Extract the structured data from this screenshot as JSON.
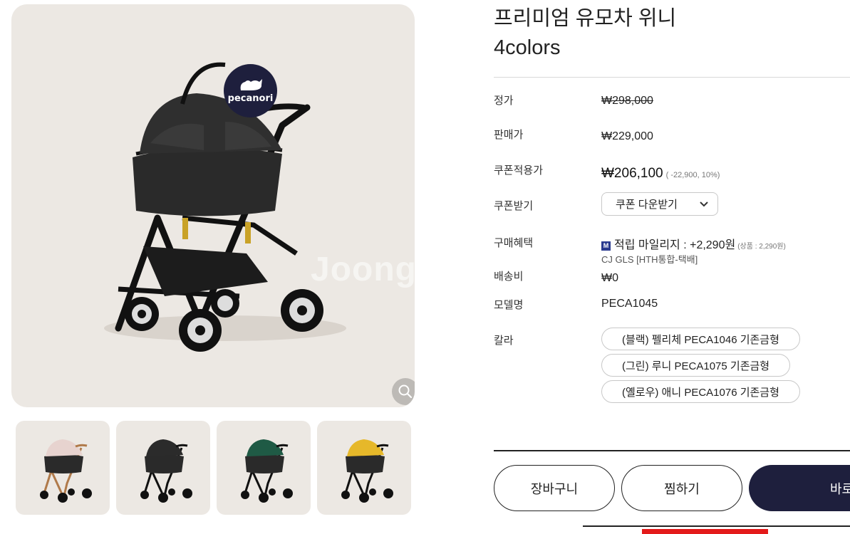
{
  "product": {
    "title_line1": "프리미엄 유모차 위니",
    "title_line2": "4colors"
  },
  "gallery": {
    "brand_badge": "pecanori",
    "watermark": "Joong",
    "thumbnails": [
      {
        "name": "rose-gold-pink",
        "canopy_color": "#e7d3cf",
        "frame_color": "#b07a4a"
      },
      {
        "name": "black",
        "canopy_color": "#2b2b2b",
        "frame_color": "#111111"
      },
      {
        "name": "green",
        "canopy_color": "#1f5a45",
        "frame_color": "#111111"
      },
      {
        "name": "yellow",
        "canopy_color": "#e6b82a",
        "frame_color": "#111111"
      }
    ]
  },
  "info": {
    "list_price_label": "정가",
    "list_price": "₩298,000",
    "sale_price_label": "판매가",
    "sale_price": "₩229,000",
    "coupon_price_label": "쿠폰적용가",
    "coupon_price": "₩206,100",
    "coupon_discount_note": "( -22,900, 10%)",
    "coupon_label": "쿠폰받기",
    "coupon_button": "쿠폰 다운받기",
    "benefit_label": "구매혜택",
    "mileage_icon": "M",
    "mileage_text": "적립 마일리지 : +2,290원",
    "mileage_note": "(상품 : 2,290원)",
    "courier": "CJ GLS [HTH통합-택배]",
    "shipping_label": "배송비",
    "shipping_value": "₩0",
    "model_label": "모델명",
    "model_value": "PECA1045",
    "color_label": "칼라",
    "color_options": [
      "(블랙) 펠리체 PECA1046 기존금형",
      "(그린) 루니 PECA1075 기존금형",
      "(옐로우) 애니 PECA1076 기존금형"
    ]
  },
  "actions": {
    "cart": "장바구니",
    "wish": "찜하기",
    "buy": "바로"
  },
  "colors": {
    "brand_navy": "#1e1f3d",
    "image_bg": "#ece8e3",
    "accent_red": "#e31a1a"
  }
}
